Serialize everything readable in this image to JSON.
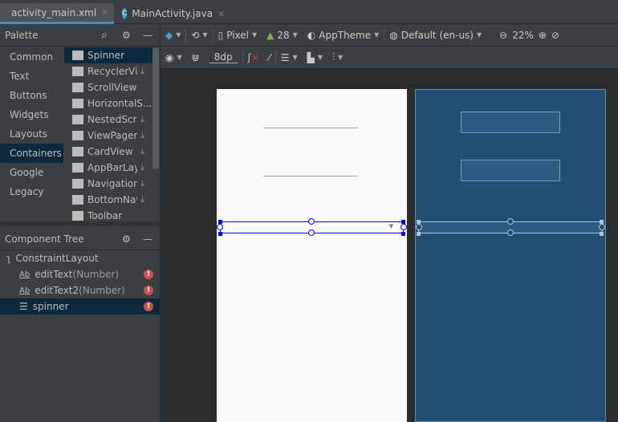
{
  "tabs": [
    {
      "label": "activity_main.xml",
      "active": true,
      "icon": "xml-layout-icon"
    },
    {
      "label": "MainActivity.java",
      "active": false,
      "icon": "class-c-icon"
    }
  ],
  "toolbar": {
    "device": "Pixel",
    "api": "28",
    "theme": "AppTheme",
    "locale": "Default (en-us)",
    "zoom": "22%",
    "margin": "8dp"
  },
  "palette": {
    "title": "Palette",
    "categories": [
      "Common",
      "Text",
      "Buttons",
      "Widgets",
      "Layouts",
      "Containers",
      "Google",
      "Legacy"
    ],
    "selected_category": "Containers",
    "items": [
      {
        "label": "Spinner",
        "download": false
      },
      {
        "label": "RecyclerView",
        "download": true
      },
      {
        "label": "ScrollView",
        "download": false
      },
      {
        "label": "HorizontalS...",
        "download": false
      },
      {
        "label": "NestedScrollView",
        "download": true
      },
      {
        "label": "ViewPager",
        "download": true
      },
      {
        "label": "CardView",
        "download": true
      },
      {
        "label": "AppBarLayout",
        "download": true
      },
      {
        "label": "NavigationView",
        "download": true
      },
      {
        "label": "BottomNavigationView",
        "download": true
      },
      {
        "label": "Toolbar",
        "download": false
      }
    ]
  },
  "component_tree": {
    "title": "Component Tree",
    "root": "ConstraintLayout",
    "children": [
      {
        "name": "editText",
        "type": "(Number)",
        "error": true
      },
      {
        "name": "editText2",
        "type": "(Number)",
        "error": true
      },
      {
        "name": "spinner",
        "type": "",
        "error": true,
        "selected": true
      }
    ]
  },
  "colors": {
    "accent": "#4a88c7",
    "selection": "#0d293e",
    "blueprint": "#224d70",
    "error": "#c75450"
  }
}
